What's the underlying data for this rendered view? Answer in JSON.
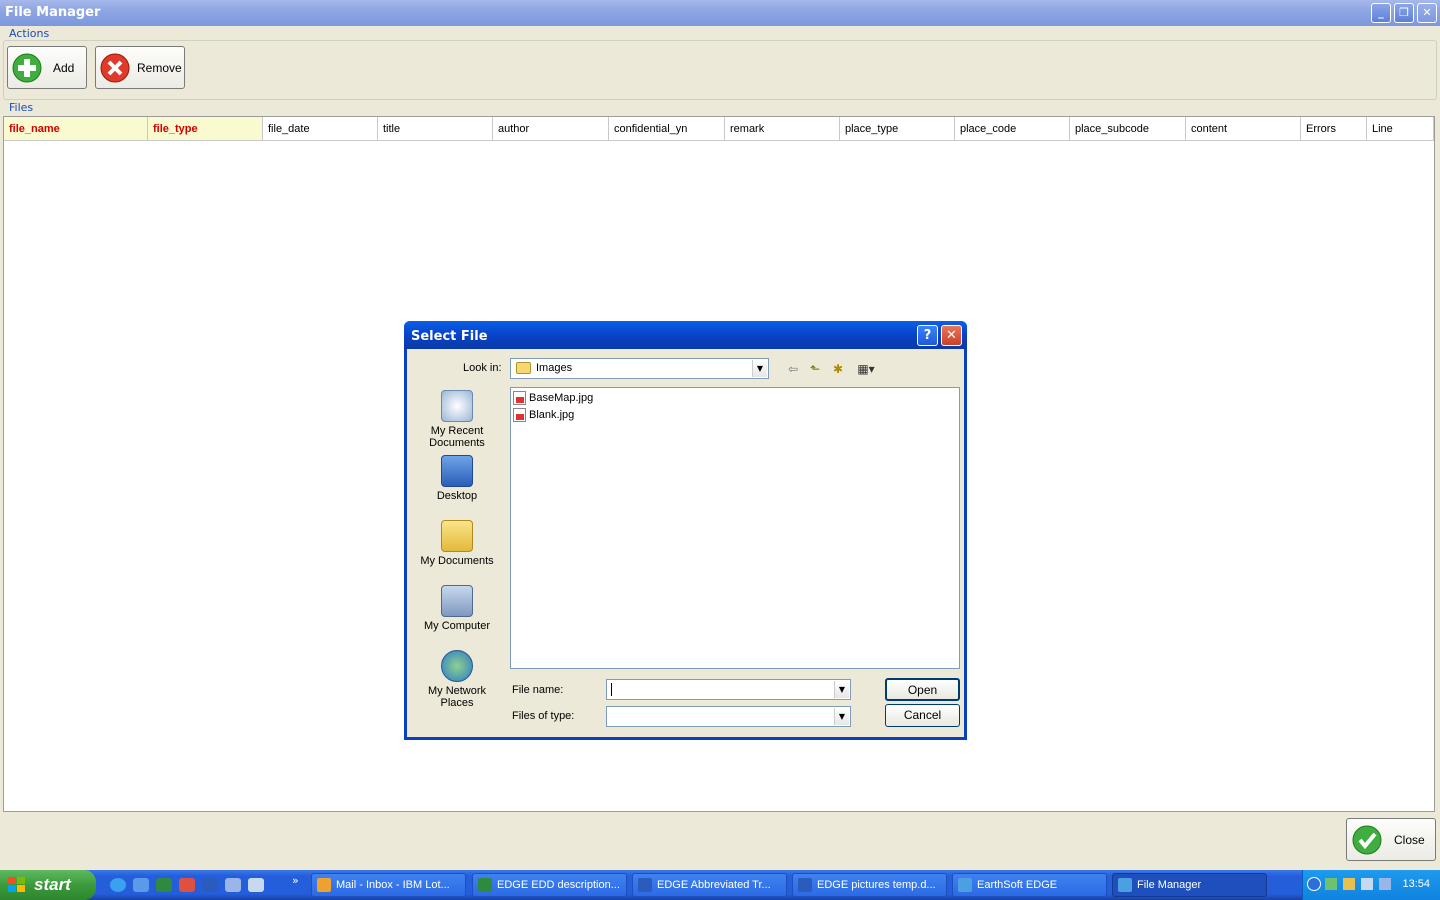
{
  "window": {
    "title": "File Manager",
    "min": "_",
    "restore": "❐",
    "close": "✕"
  },
  "actions": {
    "group_label": "Actions",
    "add_label": "Add",
    "remove_label": "Remove"
  },
  "files": {
    "group_label": "Files",
    "columns": [
      {
        "label": "file_name",
        "required": true
      },
      {
        "label": "file_type",
        "required": true
      },
      {
        "label": "file_date",
        "required": false
      },
      {
        "label": "title",
        "required": false
      },
      {
        "label": "author",
        "required": false
      },
      {
        "label": "confidential_yn",
        "required": false
      },
      {
        "label": "remark",
        "required": false
      },
      {
        "label": "place_type",
        "required": false
      },
      {
        "label": "place_code",
        "required": false
      },
      {
        "label": "place_subcode",
        "required": false
      },
      {
        "label": "content",
        "required": false
      },
      {
        "label": "Errors",
        "required": false
      },
      {
        "label": "Line",
        "required": false
      }
    ]
  },
  "footer": {
    "close_label": "Close"
  },
  "dialog": {
    "title": "Select File",
    "help": "?",
    "close": "✕",
    "look_in_label": "Look in:",
    "look_in_value": "Images",
    "places": [
      "My Recent Documents",
      "Desktop",
      "My Documents",
      "My Computer",
      "My Network Places"
    ],
    "files": [
      "BaseMap.jpg",
      "Blank.jpg"
    ],
    "file_name_label": "File name:",
    "file_name_value": "",
    "files_of_type_label": "Files of type:",
    "files_of_type_value": "",
    "open_label": "Open",
    "cancel_label": "Cancel"
  },
  "taskbar": {
    "start_label": "start",
    "chevron": "»",
    "tasks": [
      {
        "label": "Mail - Inbox - IBM Lot...",
        "icon": "lotus-notes-icon",
        "color": "#f0a030"
      },
      {
        "label": "EDGE EDD description...",
        "icon": "excel-icon",
        "color": "#2d8a3e"
      },
      {
        "label": "EDGE Abbreviated Tr...",
        "icon": "word-icon",
        "color": "#2b5bbd"
      },
      {
        "label": "EDGE pictures temp.d...",
        "icon": "word-icon",
        "color": "#2b5bbd"
      },
      {
        "label": "EarthSoft EDGE",
        "icon": "edge-icon",
        "color": "#4aa0e0"
      },
      {
        "label": "File Manager",
        "icon": "edge-icon",
        "color": "#4aa0e0"
      }
    ],
    "clock": "13:54"
  },
  "colors": {
    "accent": "#0a3fbf",
    "required_header": "#d40000",
    "required_bg": "#fafad0"
  }
}
